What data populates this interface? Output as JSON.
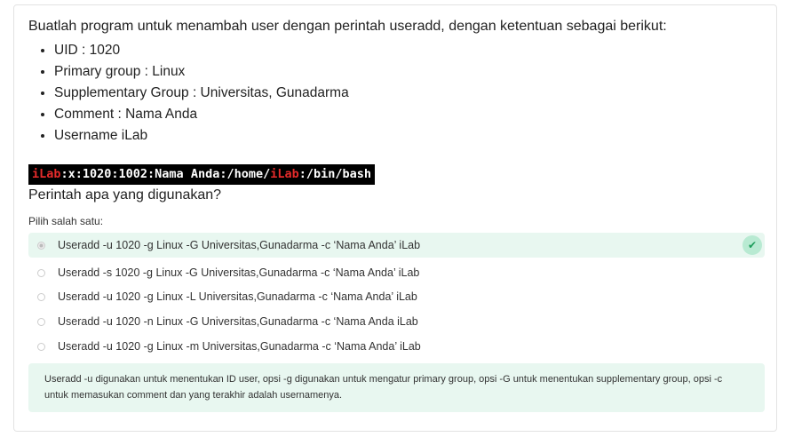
{
  "question": {
    "intro": "Buatlah program untuk menambah user dengan perintah useradd, dengan ketentuan sebagai berikut:",
    "requirements": [
      "UID : 1020",
      "Primary group : Linux",
      "Supplementary Group : Universitas, Gunadarma",
      "Comment : Nama Anda",
      "Username iLab"
    ],
    "code": {
      "user1": "iLab",
      "mid": ":x:1020:1002:Nama Anda:/home/",
      "user2": "iLab",
      "end": ":/bin/bash"
    },
    "prompt": "Perintah apa yang digunakan?"
  },
  "choices": {
    "label": "Pilih salah satu:",
    "selected_index": 0,
    "options": [
      {
        "text": "Useradd -u 1020 -g Linux -G Universitas,Gunadarma -c ‘Nama Anda’ iLab",
        "correct": true
      },
      {
        "text": "Useradd -s 1020 -g Linux -G Universitas,Gunadarma -c ‘Nama Anda’ iLab"
      },
      {
        "text": "Useradd -u 1020 -g Linux -L Universitas,Gunadarma -c ‘Nama Anda’ iLab"
      },
      {
        "text": "Useradd -u 1020 -n Linux -G Universitas,Gunadarma -c ‘Nama Anda iLab"
      },
      {
        "text": "Useradd -u 1020 -g Linux -m Universitas,Gunadarma -c ‘Nama Anda’ iLab"
      }
    ]
  },
  "feedback": "Useradd -u digunakan untuk menentukan ID user, opsi -g digunakan untuk mengatur primary group, opsi -G untuk menentukan supplementary group, opsi -c untuk memasukan comment dan yang terakhir adalah usernamenya.",
  "colors": {
    "correct_bg": "#e8f7f0",
    "check": "#1e9e5c",
    "code_highlight": "#e52b2b"
  },
  "icons": {
    "correct": "check-icon"
  }
}
